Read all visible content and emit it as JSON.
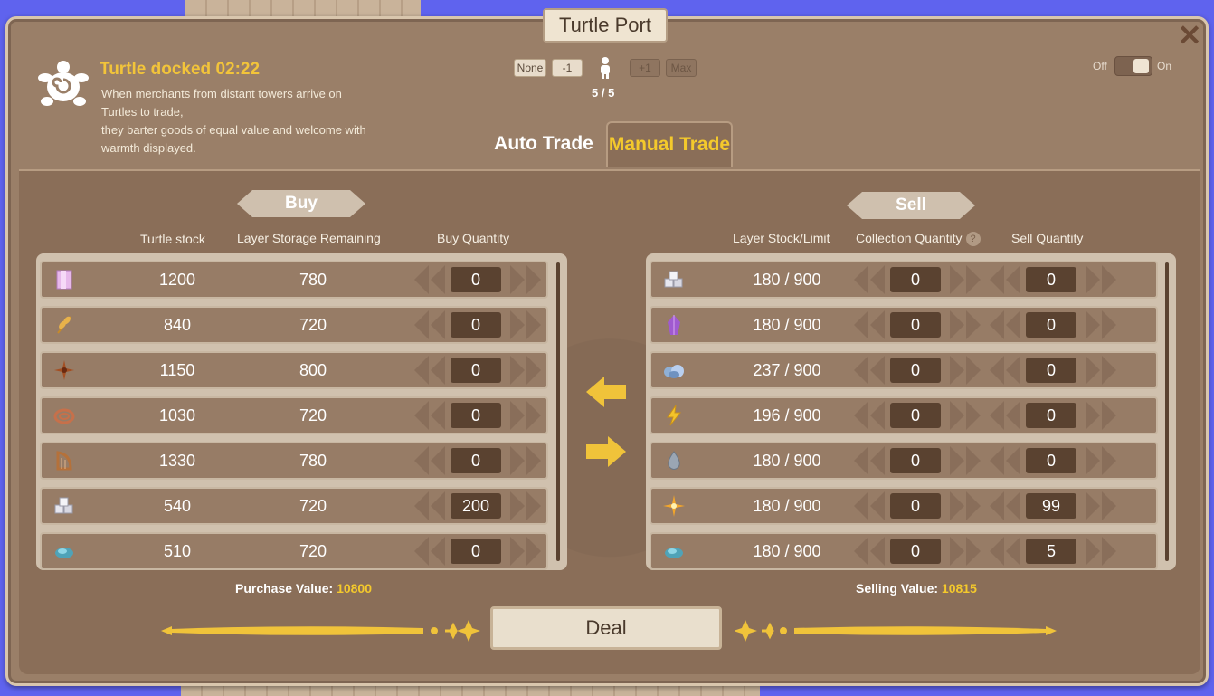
{
  "window": {
    "title": "Turtle Port",
    "close_icon": "close-icon"
  },
  "header": {
    "status": "Turtle docked 02:22",
    "description": "When merchants from distant towers arrive on Turtles to trade,\nthey barter goods of equal value and welcome with warmth displayed.",
    "crew_buttons": {
      "none": "None",
      "minus": "-1",
      "plus": "+1",
      "max": "Max"
    },
    "crew_count": "5 / 5",
    "toggle": {
      "off": "Off",
      "on": "On",
      "state": "on"
    }
  },
  "tabs": [
    {
      "label": "Auto Trade",
      "active": false
    },
    {
      "label": "Manual Trade",
      "active": true
    }
  ],
  "buy": {
    "title": "Buy",
    "columns": [
      "Turtle stock",
      "Layer Storage Remaining",
      "Buy Quantity"
    ],
    "rows": [
      {
        "icon": "pink-crystal-block-icon",
        "stock": "1200",
        "remaining": "780",
        "quantity": "0"
      },
      {
        "icon": "wheat-icon",
        "stock": "840",
        "remaining": "720",
        "quantity": "0"
      },
      {
        "icon": "star-anise-icon",
        "stock": "1150",
        "remaining": "800",
        "quantity": "0"
      },
      {
        "icon": "rope-coil-icon",
        "stock": "1030",
        "remaining": "720",
        "quantity": "0"
      },
      {
        "icon": "harp-icon",
        "stock": "1330",
        "remaining": "780",
        "quantity": "0"
      },
      {
        "icon": "stone-blocks-icon",
        "stock": "540",
        "remaining": "720",
        "quantity": "200"
      },
      {
        "icon": "blue-ore-icon",
        "stock": "510",
        "remaining": "720",
        "quantity": "0"
      }
    ],
    "value_label": "Purchase Value:",
    "value": "10800"
  },
  "sell": {
    "title": "Sell",
    "columns": [
      "Layer Stock/Limit",
      "Collection Quantity",
      "Sell Quantity"
    ],
    "help_icon": "?",
    "rows": [
      {
        "icon": "stone-blocks-icon",
        "stock_limit": "180 / 900",
        "collection": "0",
        "quantity": "0"
      },
      {
        "icon": "purple-crystal-icon",
        "stock_limit": "180 / 900",
        "collection": "0",
        "quantity": "0"
      },
      {
        "icon": "blue-rock-icon",
        "stock_limit": "237 / 900",
        "collection": "0",
        "quantity": "0"
      },
      {
        "icon": "lightning-icon",
        "stock_limit": "196 / 900",
        "collection": "0",
        "quantity": "0"
      },
      {
        "icon": "water-drop-icon",
        "stock_limit": "180 / 900",
        "collection": "0",
        "quantity": "0"
      },
      {
        "icon": "sparkle-star-icon",
        "stock_limit": "180 / 900",
        "collection": "0",
        "quantity": "99"
      },
      {
        "icon": "blue-ore-icon",
        "stock_limit": "180 / 900",
        "collection": "0",
        "quantity": "5"
      }
    ],
    "value_label": "Selling Value:",
    "value": "10815"
  },
  "actions": {
    "deal": "Deal"
  },
  "colors": {
    "accent": "#f4c92c",
    "panel": "#9a7f68",
    "inner": "#8a6e58",
    "qty_box": "#5a4230"
  }
}
